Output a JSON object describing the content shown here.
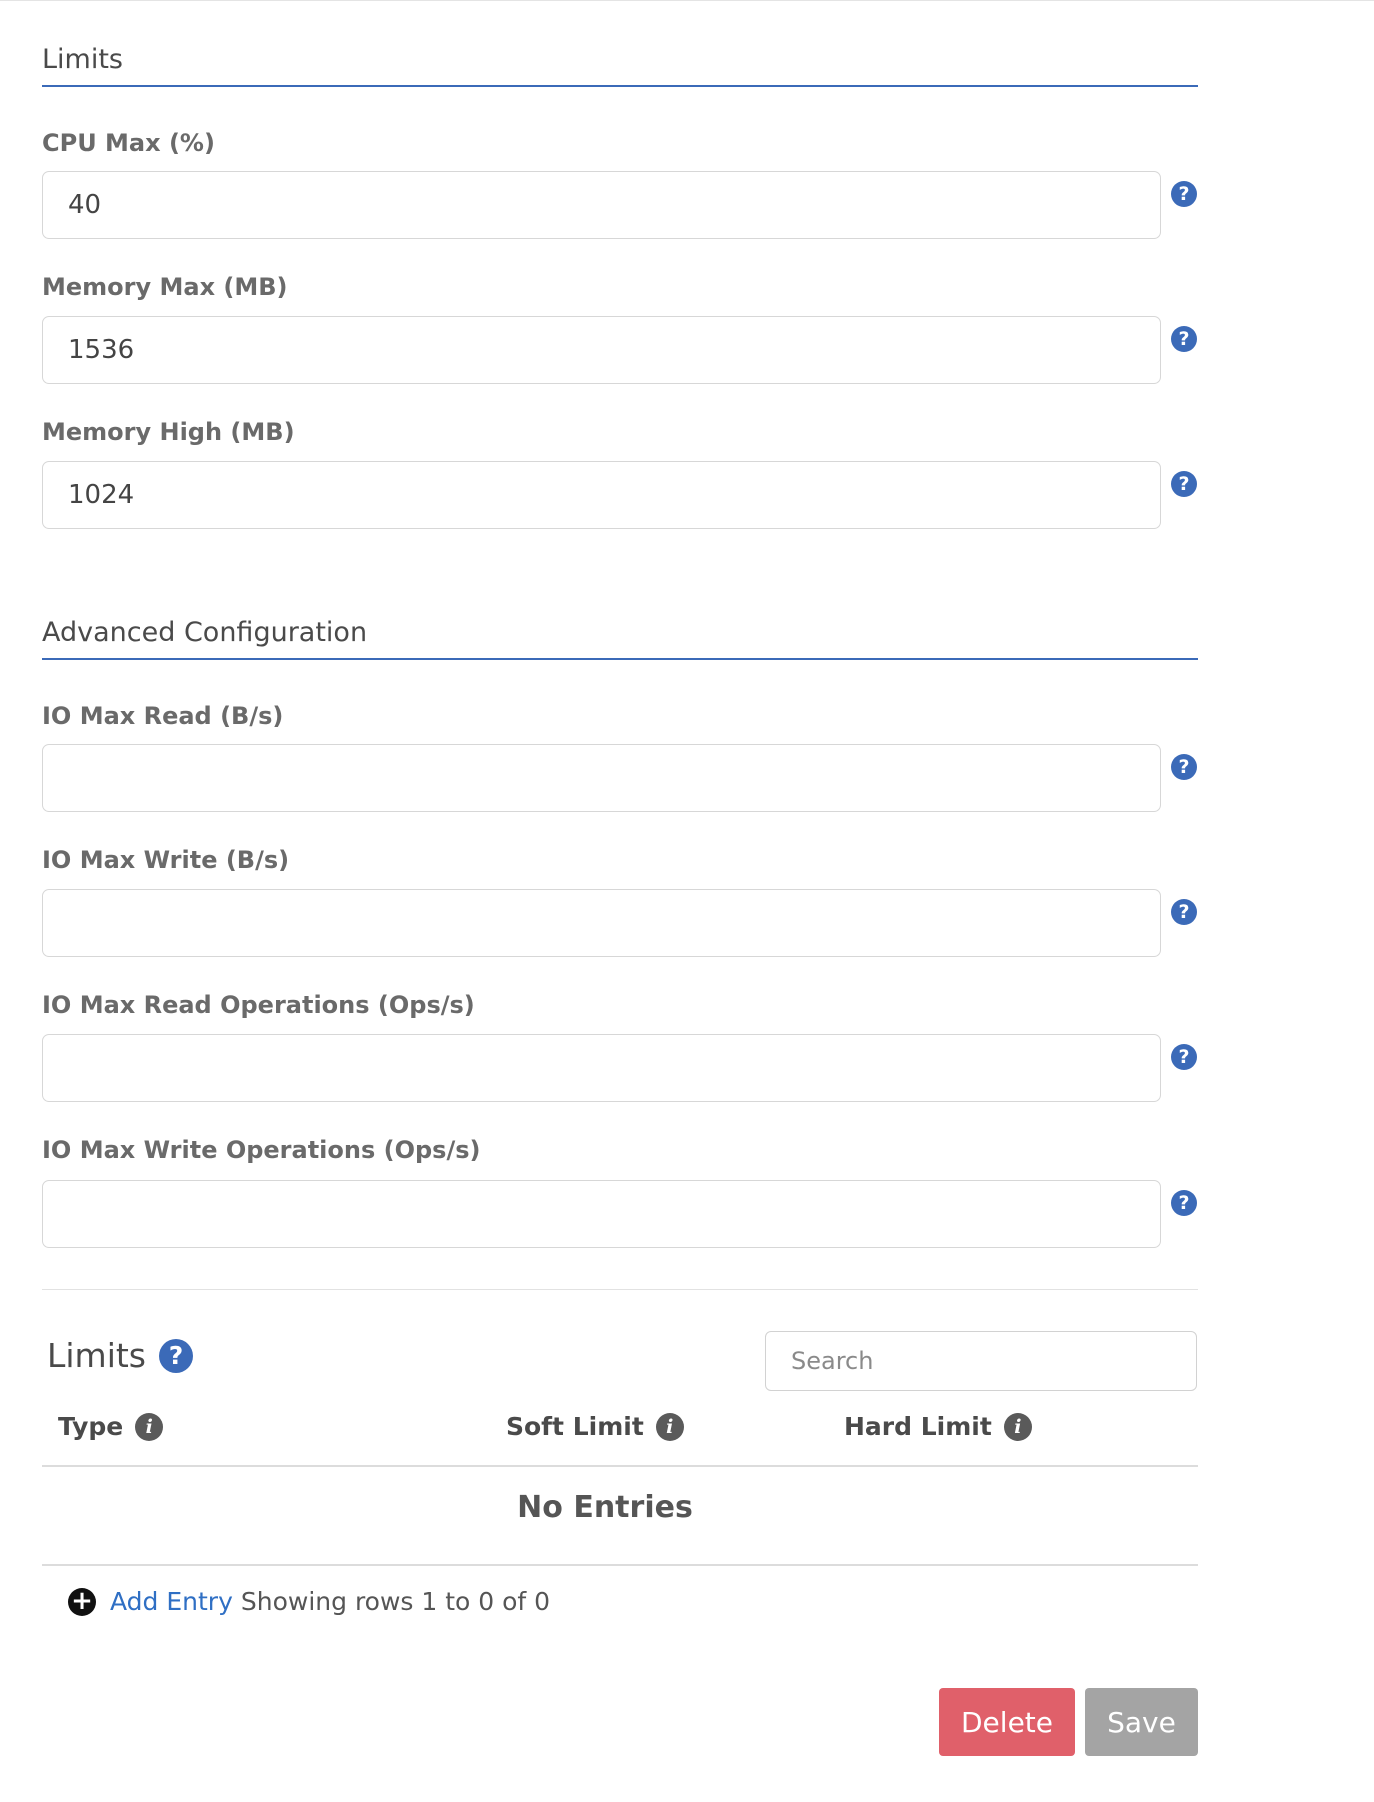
{
  "limits_section": {
    "heading": "Limits",
    "fields": [
      {
        "label": "CPU Max (%)",
        "value": "40",
        "placeholder": ""
      },
      {
        "label": "Memory Max (MB)",
        "value": "1536",
        "placeholder": ""
      },
      {
        "label": "Memory High (MB)",
        "value": "1024",
        "placeholder": ""
      }
    ]
  },
  "advanced_section": {
    "heading": "Advanced Configuration",
    "fields": [
      {
        "label": "IO Max Read (B/s)",
        "value": "",
        "placeholder": ""
      },
      {
        "label": "IO Max Write (B/s)",
        "value": "",
        "placeholder": ""
      },
      {
        "label": "IO Max Read Operations (Ops/s)",
        "value": "",
        "placeholder": ""
      },
      {
        "label": "IO Max Write Operations (Ops/s)",
        "value": "",
        "placeholder": ""
      }
    ]
  },
  "icons": {
    "help": "?",
    "info": "i",
    "plus": "+"
  },
  "limits_table": {
    "title": "Limits",
    "search_placeholder": "Search",
    "columns": [
      {
        "label": "Type"
      },
      {
        "label": "Soft Limit"
      },
      {
        "label": "Hard Limit"
      }
    ],
    "empty_text": "No Entries",
    "add_entry_label": "Add Entry",
    "rows_info": "Showing rows 1 to 0 of 0"
  },
  "actions": {
    "delete_label": "Delete",
    "save_label": "Save"
  },
  "colors": {
    "accent": "#3b6ab8",
    "danger": "#e0606a",
    "disabled": "#a4a4a4"
  }
}
